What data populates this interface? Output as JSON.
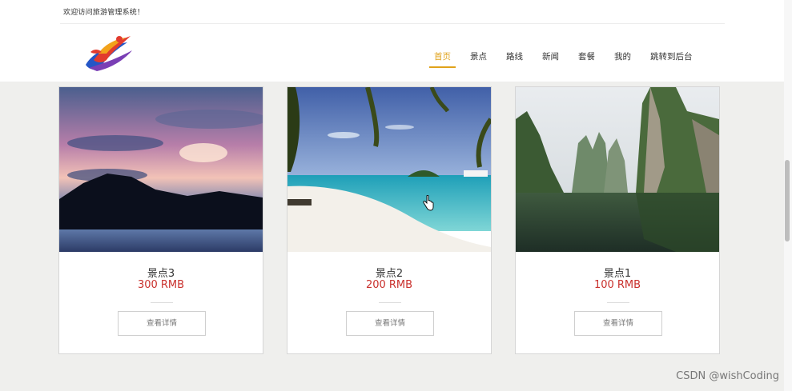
{
  "header": {
    "welcome": "欢迎访问旅游管理系统！",
    "logo_icon": "travel-logo-icon"
  },
  "nav": {
    "active_color": "#e0a21a",
    "items": [
      {
        "label": "首页",
        "active": true
      },
      {
        "label": "景点",
        "active": false
      },
      {
        "label": "路线",
        "active": false
      },
      {
        "label": "新闻",
        "active": false
      },
      {
        "label": "套餐",
        "active": false
      },
      {
        "label": "我的",
        "active": false
      },
      {
        "label": "跳转到后台",
        "active": false
      }
    ]
  },
  "cards": [
    {
      "name": "景点3",
      "price": "300 RMB",
      "button": "查看详情",
      "image": "sunset-lake-photo"
    },
    {
      "name": "景点2",
      "price": "200 RMB",
      "button": "查看详情",
      "image": "beach-palm-photo"
    },
    {
      "name": "景点1",
      "price": "100 RMB",
      "button": "查看详情",
      "image": "karst-river-photo"
    }
  ],
  "colors": {
    "price": "#c9302c",
    "page_bg": "#efefed"
  },
  "watermark": "CSDN @wishCoding"
}
